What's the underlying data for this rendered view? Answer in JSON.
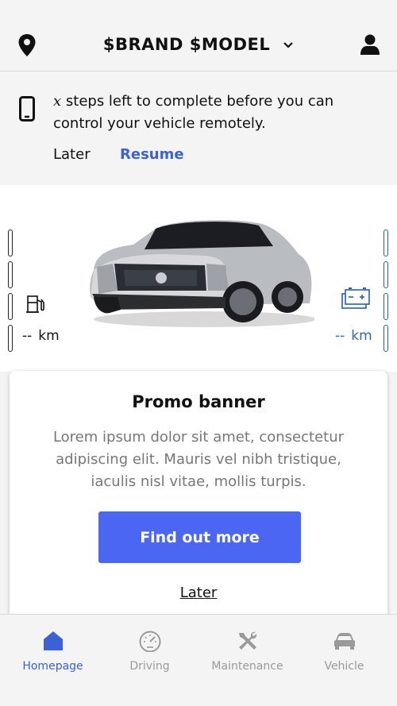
{
  "header": {
    "title": "$BRAND $MODEL",
    "icons": {
      "location": "location-pin-icon",
      "dropdown": "chevron-down-icon",
      "profile": "user-profile-icon"
    }
  },
  "notice": {
    "variable": "x",
    "message": " steps left to complete before you can control your vehicle remotely.",
    "later_label": "Later",
    "resume_label": "Resume",
    "icon": "smartphone-icon"
  },
  "vehicle": {
    "fuel_range_value": "--",
    "fuel_range_unit": "km",
    "battery_range_value": "--",
    "battery_range_unit": "km",
    "icons": {
      "fuel": "fuel-pump-icon",
      "battery": "battery-icon"
    }
  },
  "promo": {
    "title": "Promo banner",
    "body": "Lorem ipsum dolor sit amet, consectetur adipiscing elit. Mauris vel nibh tristique, iaculis nisl vitae, mollis turpis.",
    "cta_label": "Find out more",
    "later_label": "Later"
  },
  "nav": {
    "items": [
      {
        "label": "Homepage",
        "icon": "home-icon",
        "active": true
      },
      {
        "label": "Driving",
        "icon": "speedometer-icon",
        "active": false
      },
      {
        "label": "Maintenance",
        "icon": "tools-icon",
        "active": false
      },
      {
        "label": "Vehicle",
        "icon": "car-icon",
        "active": false
      }
    ]
  },
  "colors": {
    "accent": "#3a62d6",
    "cta": "#4a66f2",
    "range_blue": "#2b6cb0",
    "background": "#f4f4f4"
  }
}
